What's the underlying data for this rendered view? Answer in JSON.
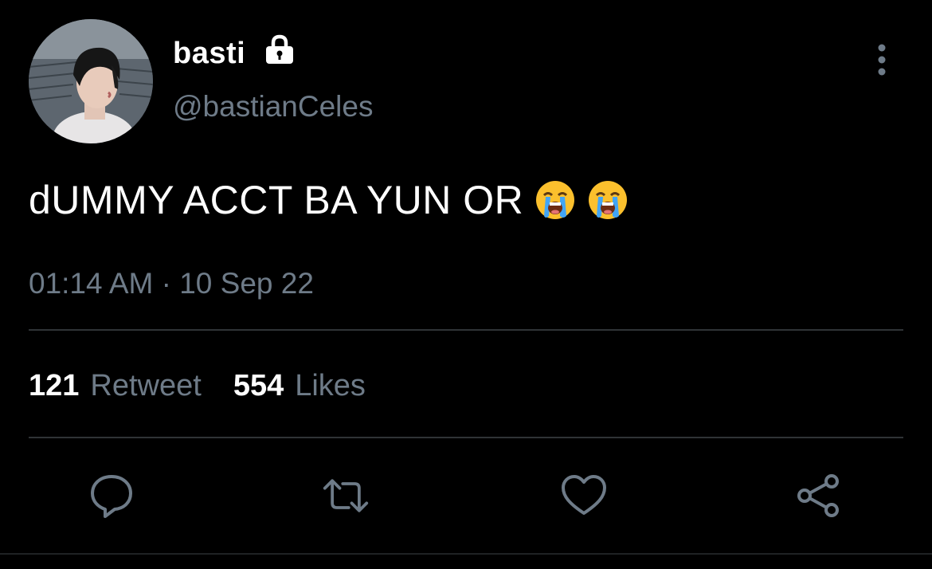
{
  "user": {
    "display_name": "basti",
    "handle": "@bastianCeles",
    "protected_icon": "lock-icon"
  },
  "tweet": {
    "text": "dUMMY ACCT BA YUN OR",
    "emojis": [
      "loudly-crying-face",
      "loudly-crying-face"
    ],
    "timestamp": "01:14 AM · 10 Sep 22"
  },
  "stats": {
    "retweets_count": "121",
    "retweets_label": "Retweet",
    "likes_count": "554",
    "likes_label": "Likes"
  },
  "actions": {
    "reply_icon": "reply-icon",
    "retweet_icon": "retweet-icon",
    "like_icon": "heart-icon",
    "share_icon": "share-icon"
  },
  "colors": {
    "background": "#000000",
    "primary_text": "#ffffff",
    "secondary_text": "#6e7b88",
    "divider": "#2f3336",
    "icon": "#6e7b88"
  }
}
